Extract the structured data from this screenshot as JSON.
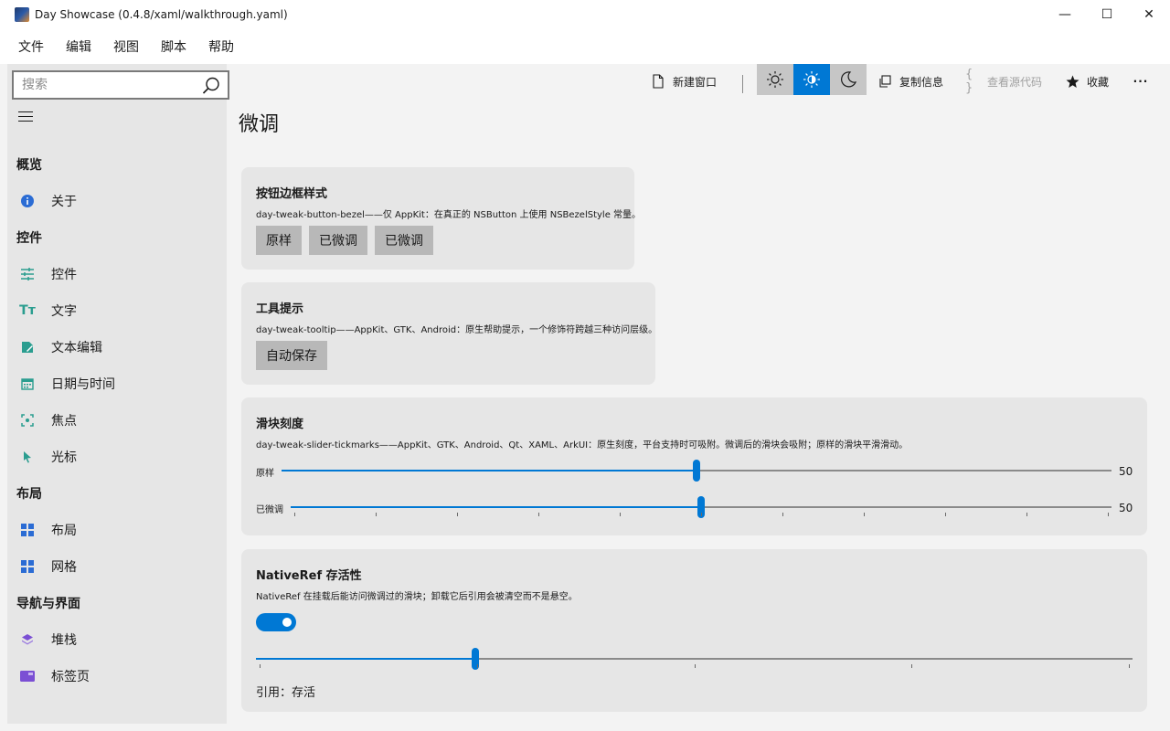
{
  "window": {
    "title": "Day Showcase (0.4.8/xaml/walkthrough.yaml)",
    "minimize_glyph": "—",
    "maximize_glyph": "☐",
    "close_glyph": "✕"
  },
  "menu": [
    "文件",
    "编辑",
    "视图",
    "脚本",
    "帮助"
  ],
  "search": {
    "placeholder": "搜索",
    "value": ""
  },
  "sidebar": {
    "groups": [
      {
        "label": "概览",
        "items": [
          {
            "label": "关于",
            "icon": "info-icon",
            "color": "#0078d4"
          }
        ]
      },
      {
        "label": "控件",
        "items": [
          {
            "label": "控件",
            "icon": "sliders-icon",
            "color": "#2a9d8f"
          },
          {
            "label": "文字",
            "icon": "text-size-icon",
            "color": "#2a9d8f"
          },
          {
            "label": "文本编辑",
            "icon": "edit-icon",
            "color": "#2a9d8f"
          },
          {
            "label": "日期与时间",
            "icon": "calendar-icon",
            "color": "#2a9d8f"
          },
          {
            "label": "焦点",
            "icon": "focus-icon",
            "color": "#2a9d8f"
          },
          {
            "label": "光标",
            "icon": "cursor-icon",
            "color": "#2a9d8f"
          }
        ]
      },
      {
        "label": "布局",
        "items": [
          {
            "label": "布局",
            "icon": "grid-layout-icon",
            "color": "#2b6cd4"
          },
          {
            "label": "网格",
            "icon": "grid-icon",
            "color": "#2b6cd4"
          }
        ]
      },
      {
        "label": "导航与界面",
        "items": [
          {
            "label": "堆栈",
            "icon": "stack-icon",
            "color": "#7b4fd4"
          },
          {
            "label": "标签页",
            "icon": "tabs-icon",
            "color": "#7b4fd4"
          }
        ]
      }
    ]
  },
  "toolbar": {
    "new_window": "新建窗口",
    "copy_info": "复制信息",
    "view_source": "查看源代码",
    "favorite": "收藏",
    "more": "···",
    "theme_active": "system",
    "accent": "#0078d4"
  },
  "main": {
    "title": "微调",
    "cards": {
      "bezel": {
        "title": "按钮边框样式",
        "desc": "day-tweak-button-bezel——仅 AppKit：在真正的 NSButton 上使用 NSBezelStyle 常量。",
        "buttons": [
          "原样",
          "已微调",
          "已微调"
        ]
      },
      "tooltip": {
        "title": "工具提示",
        "desc": "day-tweak-tooltip——AppKit、GTK、Android：原生帮助提示，一个修饰符跨越三种访问层级。",
        "button": "自动保存"
      },
      "slider": {
        "title": "滑块刻度",
        "desc": "day-tweak-slider-tickmarks——AppKit、GTK、Android、Qt、XAML、ArkUI：原生刻度，平台支持时可吸附。微调后的滑块会吸附；原样的滑块平滑滑动。",
        "rows": [
          {
            "label": "原样",
            "value": 50,
            "display": "50",
            "min": 0,
            "max": 100,
            "ticks": 0
          },
          {
            "label": "已微调",
            "value": 50,
            "display": "50",
            "min": 0,
            "max": 100,
            "ticks": 11
          }
        ]
      },
      "nativeref": {
        "title": "NativeRef 存活性",
        "desc": "NativeRef 在挂载后能访问微调过的滑块；卸载它后引用会被清空而不是悬空。",
        "toggle_on": true,
        "slider": {
          "value": 25,
          "min": 0,
          "max": 100,
          "ticks": 5
        },
        "ref_label": "引用：存活"
      }
    }
  }
}
